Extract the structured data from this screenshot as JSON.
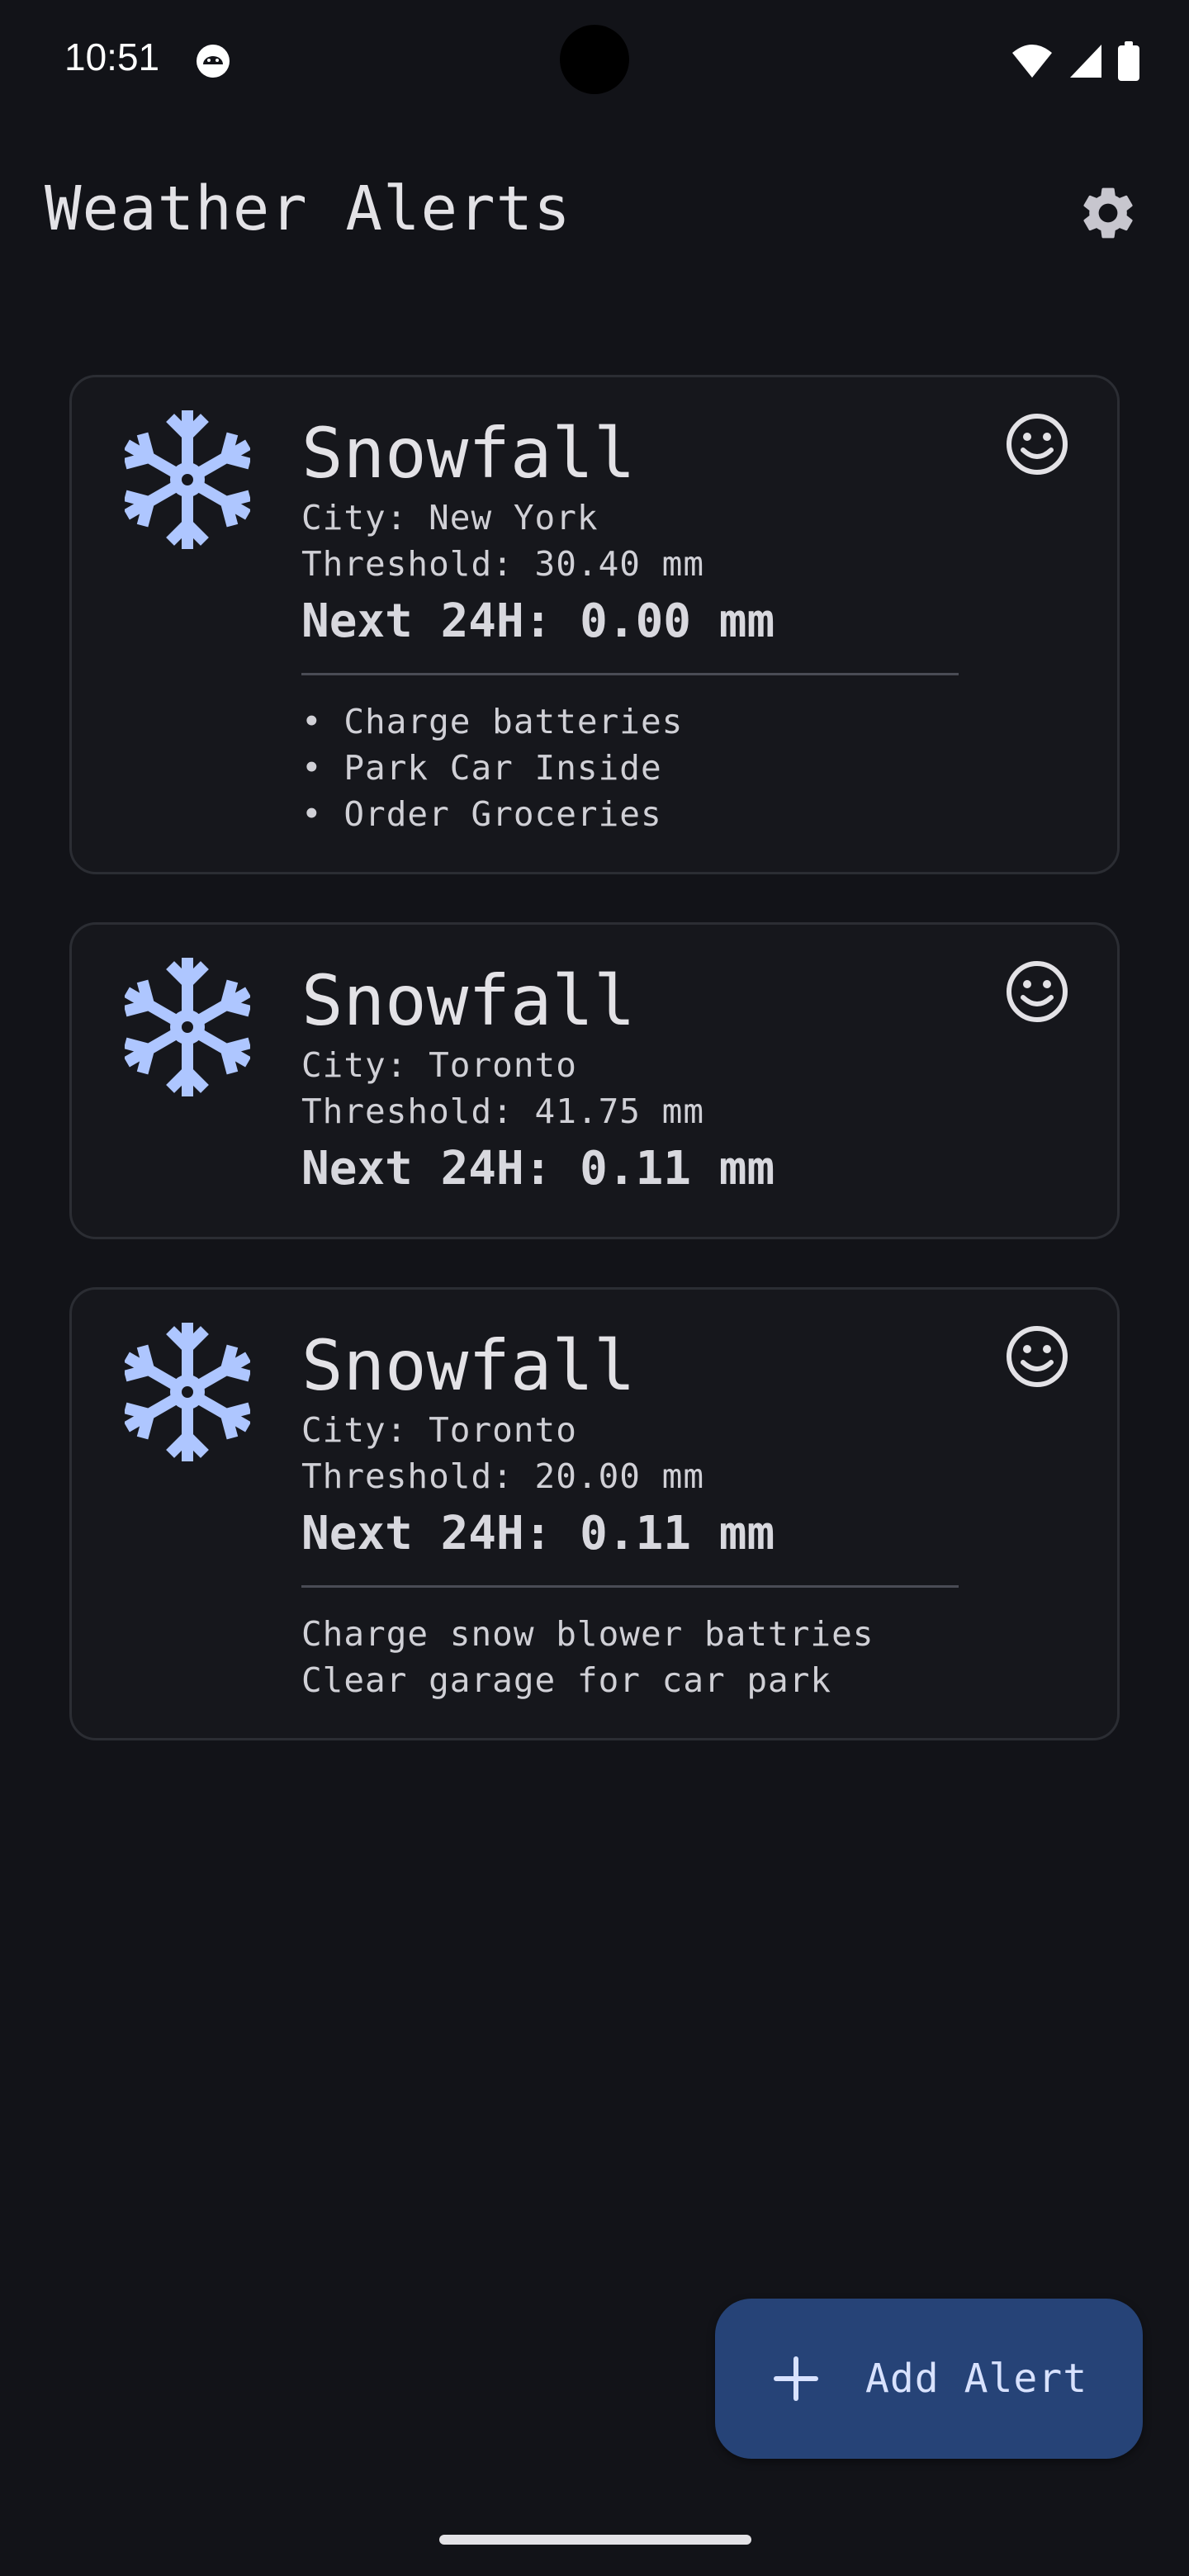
{
  "status_bar": {
    "time": "10:51",
    "icons": [
      "android-app-icon",
      "wifi-icon",
      "signal-icon",
      "battery-icon"
    ]
  },
  "app_bar": {
    "title": "Weather Alerts",
    "settings_icon": "gear-icon"
  },
  "colors": {
    "background": "#121318",
    "card_border": "#2b2d33",
    "snowflake": "#aec6ff",
    "fab": "#264377",
    "fab_text": "#d8e2ff"
  },
  "alerts": [
    {
      "icon": "snowflake-icon",
      "title": "Snowfall",
      "city": "City: New York",
      "threshold": "Threshold: 30.40 mm",
      "next": "Next 24H: 0.00 mm",
      "mood_icon": "smiley-icon",
      "notes": "• Charge batteries\n• Park Car Inside\n• Order Groceries"
    },
    {
      "icon": "snowflake-icon",
      "title": "Snowfall",
      "city": "City: Toronto",
      "threshold": "Threshold: 41.75 mm",
      "next": "Next 24H: 0.11 mm",
      "mood_icon": "smiley-icon"
    },
    {
      "icon": "snowflake-icon",
      "title": "Snowfall",
      "city": "City: Toronto",
      "threshold": "Threshold: 20.00 mm",
      "next": "Next 24H: 0.11 mm",
      "mood_icon": "smiley-icon",
      "notes": "Charge snow blower battries\nClear garage for car park"
    }
  ],
  "fab": {
    "icon": "plus-icon",
    "label": "Add Alert"
  }
}
